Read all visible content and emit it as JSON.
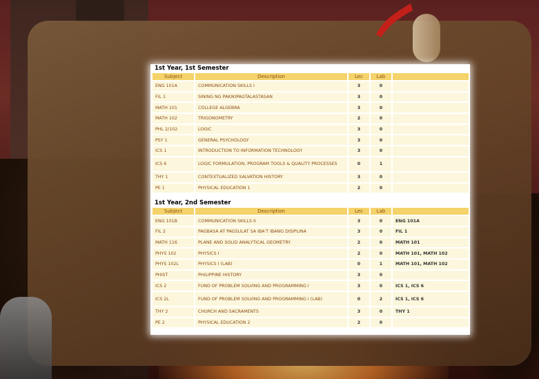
{
  "columns": {
    "subject": "Subject",
    "description": "Description",
    "lec": "Lec",
    "lab": "Lab"
  },
  "semesters": [
    {
      "title": "1st Year, 1st Semester",
      "rows": [
        {
          "subject": "ENG 101A",
          "description": "COMMUNICATION SKILLS I",
          "lec": "3",
          "lab": "0",
          "prereq": ""
        },
        {
          "subject": "FIL 1",
          "description": "SINING NG PAKIKIPAGTALASTASAN",
          "lec": "3",
          "lab": "0",
          "prereq": ""
        },
        {
          "subject": "MATH 101",
          "description": "COLLEGE ALGEBRA",
          "lec": "3",
          "lab": "0",
          "prereq": ""
        },
        {
          "subject": "MATH 102",
          "description": "TRIGONOMETRY",
          "lec": "2",
          "lab": "0",
          "prereq": ""
        },
        {
          "subject": "PHL 2/102",
          "description": "LOGIC",
          "lec": "3",
          "lab": "0",
          "prereq": ""
        },
        {
          "subject": "PSY 1",
          "description": "GENERAL PSYCHOLOGY",
          "lec": "3",
          "lab": "0",
          "prereq": ""
        },
        {
          "subject": "ICS 1",
          "description": "INTRODUCTION TO INFORMATION TECHNOLOGY",
          "lec": "3",
          "lab": "0",
          "prereq": ""
        },
        {
          "subject": "ICS 6",
          "description": "LOGIC FORMULATION, PROGRAM TOOLS & QUALITY PROCESSES",
          "lec": "0",
          "lab": "1",
          "prereq": ""
        },
        {
          "subject": "THY 1",
          "description": "CONTEXTUALIZED SALVATION HISTORY",
          "lec": "3",
          "lab": "0",
          "prereq": ""
        },
        {
          "subject": "PE 1",
          "description": "PHYSICAL EDUCATION 1",
          "lec": "2",
          "lab": "0",
          "prereq": ""
        }
      ]
    },
    {
      "title": "1st Year, 2nd Semester",
      "rows": [
        {
          "subject": "ENG 101B",
          "description": "COMMUNICATION SKILLS II",
          "lec": "3",
          "lab": "0",
          "prereq": "ENG 101A"
        },
        {
          "subject": "FIL 2",
          "description": "PAGBASA AT PAGSULAT SA IBA'T IBANG DISIPLINA",
          "lec": "3",
          "lab": "0",
          "prereq": "FIL 1"
        },
        {
          "subject": "MATH 116",
          "description": "PLANE AND SOLID ANALYTICAL GEOMETRY",
          "lec": "2",
          "lab": "0",
          "prereq": "MATH 101"
        },
        {
          "subject": "PHYS 102",
          "description": "PHYSICS I",
          "lec": "2",
          "lab": "0",
          "prereq": "MATH 101, MATH 102"
        },
        {
          "subject": "PHYS 102L",
          "description": "PHYSICS I (LAB)",
          "lec": "0",
          "lab": "1",
          "prereq": "MATH 101, MATH 102"
        },
        {
          "subject": "PHIST",
          "description": "PHILIPPINE HISTORY",
          "lec": "3",
          "lab": "0",
          "prereq": ""
        },
        {
          "subject": "ICS 2",
          "description": "FUND OF PROBLEM SOLVING AND PROGRAMMING I",
          "lec": "3",
          "lab": "0",
          "prereq": "ICS 1, ICS 6"
        },
        {
          "subject": "ICS 2L",
          "description": "FUND OF PROBLEM SOLVING AND PROGRAMMING I (LAB)",
          "lec": "0",
          "lab": "2",
          "prereq": "ICS 1, ICS 6"
        },
        {
          "subject": "THY 2",
          "description": "CHURCH AND SACRAMENTS",
          "lec": "3",
          "lab": "0",
          "prereq": "THY 1"
        },
        {
          "subject": "PE 2",
          "description": "PHYSICAL EDUCATION 2",
          "lec": "2",
          "lab": "0",
          "prereq": ""
        }
      ]
    }
  ]
}
